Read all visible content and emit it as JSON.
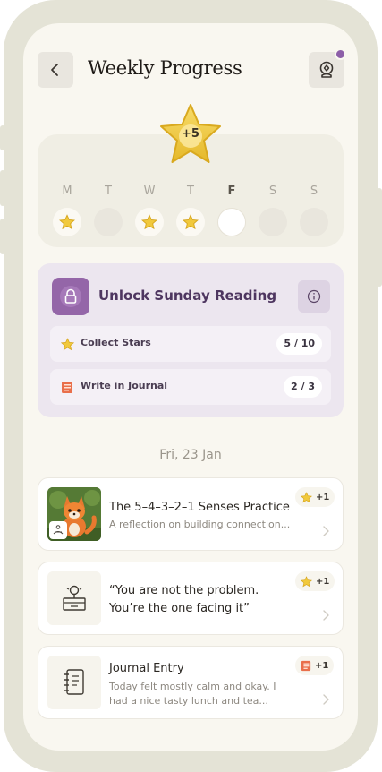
{
  "header": {
    "title": "Weekly Progress",
    "back_icon": "chevron-left-icon",
    "profile_icon": "webcam-icon",
    "notification_color": "#8d5fa8"
  },
  "week": {
    "bonus_label": "+5",
    "days": [
      {
        "letter": "M",
        "status": "starred"
      },
      {
        "letter": "T",
        "status": "empty"
      },
      {
        "letter": "W",
        "status": "starred"
      },
      {
        "letter": "T",
        "status": "starred"
      },
      {
        "letter": "F",
        "status": "today"
      },
      {
        "letter": "S",
        "status": "empty"
      },
      {
        "letter": "S",
        "status": "empty"
      }
    ]
  },
  "unlock": {
    "title": "Unlock Sunday Reading",
    "accent_color": "#9466a8",
    "tasks": [
      {
        "icon": "star-icon",
        "label": "Collect Stars",
        "progress": "5 / 10"
      },
      {
        "icon": "journal-icon",
        "label": "Write in Journal",
        "progress": "2 / 3"
      }
    ]
  },
  "date_label": "Fri, 23 Jan",
  "entries": [
    {
      "title": "The 5–4–3–2–1 Senses Practice",
      "subtitle": "A reflection on building connection...",
      "reward": "+1",
      "reward_icon": "star-icon"
    },
    {
      "title": "“You are not the problem. You’re the one facing it”",
      "reward": "+1",
      "reward_icon": "star-icon"
    },
    {
      "title": "Journal Entry",
      "subtitle": "Today felt mostly calm and okay. I had a nice tasty lunch and tea...",
      "reward": "+1",
      "reward_icon": "journal-icon"
    }
  ]
}
